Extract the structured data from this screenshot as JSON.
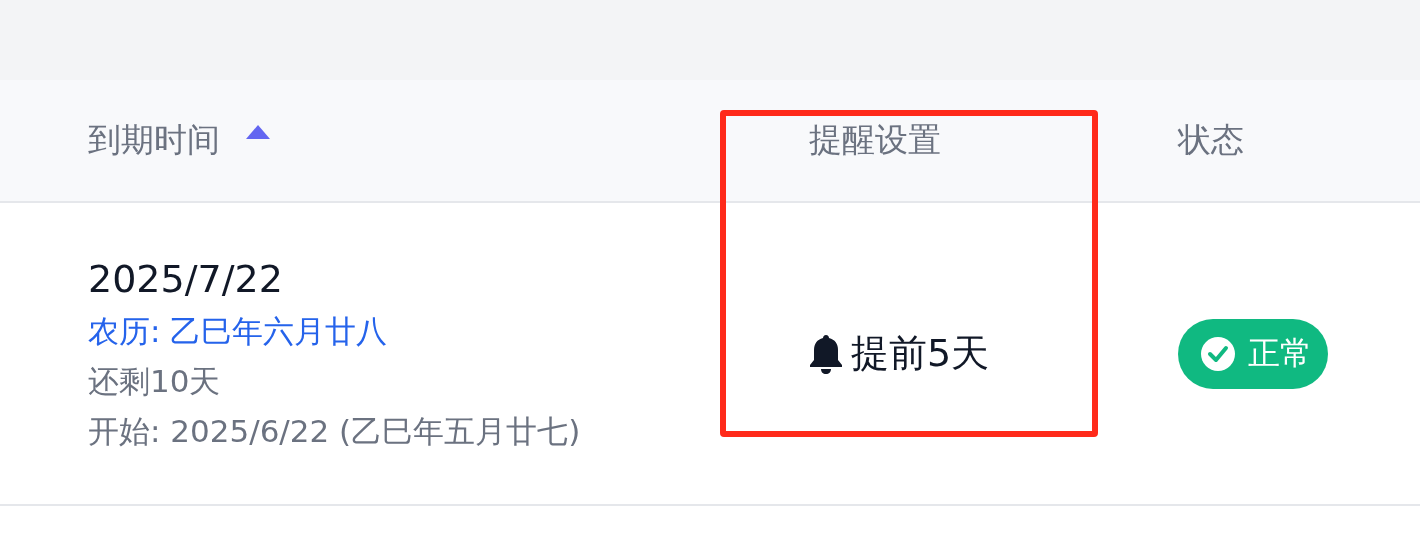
{
  "table": {
    "columns": [
      {
        "label": "到期时间",
        "sorted_ascending": true
      },
      {
        "label": "提醒设置",
        "sorted_ascending": false
      },
      {
        "label": "状态",
        "sorted_ascending": false
      }
    ],
    "rows": [
      {
        "due_date": "2025/7/22",
        "lunar": "农历: 乙巳年六月廿八",
        "remaining": "还剩10天",
        "start": "开始: 2025/6/22 (乙巳年五月廿七)",
        "reminder": "提前5天",
        "status": {
          "label": "正常",
          "kind": "normal"
        }
      }
    ]
  }
}
